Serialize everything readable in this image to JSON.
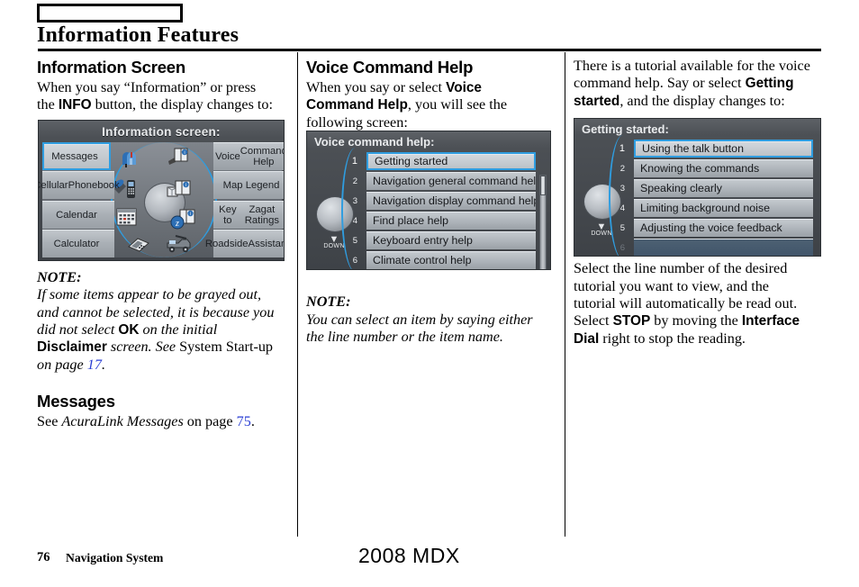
{
  "header": {
    "title": "Information Features",
    "tab_box_label": ""
  },
  "colors": {
    "link": "#2b3fd4",
    "nav_highlight": "#2f9de0"
  },
  "column1": {
    "section_title": "Information Screen",
    "intro_1": "When you say “Information” or press",
    "intro_2_pre": "the ",
    "intro_2_bold": "INFO",
    "intro_2_post": " button, the display changes to:",
    "note_label": "NOTE:",
    "note_l1": "If some items appear to be grayed out,",
    "note_l2": "and cannot be selected, it is because you",
    "note_l3_pre": "did not select ",
    "note_l3_bold": "OK",
    "note_l3_post": " on the initial",
    "note_l4_bold": "Disclaimer",
    "note_l4_mid": " screen. See ",
    "note_l4_rom": "System Start-up",
    "note_l5_pre": "on page ",
    "note_l5_page": "17",
    "note_l5_post": ".",
    "messages_title": "Messages",
    "messages_pre": "See ",
    "messages_italic": "AcuraLink Messages",
    "messages_mid": " on page ",
    "messages_page": "75",
    "messages_post": "."
  },
  "column2": {
    "section_title": "Voice Command Help",
    "intro_pre": "When you say or select ",
    "intro_bold_1": "Voice",
    "intro_bold_2": "Command Help",
    "intro_post": ", you will see the",
    "intro_last": "following screen:",
    "note_label": "NOTE:",
    "note_l1": "You can select an item by saying either",
    "note_l2": "the line number or the item name."
  },
  "column3": {
    "intro_l1": "There is a tutorial available for the voice",
    "intro_l2_pre": "command help. Say or select ",
    "intro_l2_bold": "Getting",
    "intro_l3_bold": "started",
    "intro_l3_post": ", and the display changes to:",
    "after_l1": "Select the line number of the desired",
    "after_l2": "tutorial you want to view, and the",
    "after_l3": "tutorial will automatically be read out.",
    "after_l4_pre": "Select ",
    "after_l4_bold": "STOP",
    "after_l4_mid": " by moving the ",
    "after_l4_bold2": "Interface",
    "after_l5_bold": "Dial",
    "after_l5_post": " right to stop the reading."
  },
  "screen_information": {
    "title": "Information screen:",
    "left_items": [
      {
        "label": "Messages",
        "selected": true
      },
      {
        "label": "Cellular\nPhonebook",
        "selected": false
      },
      {
        "label": "Calendar",
        "selected": false
      },
      {
        "label": "Calculator",
        "selected": false
      }
    ],
    "right_items": [
      {
        "label": "Voice\nCommand Help",
        "selected": false
      },
      {
        "label": "Map Legend",
        "selected": false
      },
      {
        "label": "Key to\nZagat Ratings",
        "selected": false
      },
      {
        "label": "Roadside\nAssistance",
        "selected": false
      }
    ],
    "icons": [
      "mailbox-icon",
      "book-info-icon",
      "satellite-phone-icon",
      "map-book-icon",
      "calendar-icon",
      "zagat-book-icon",
      "calculator-icon",
      "tow-truck-icon"
    ]
  },
  "screen_voice_command_help": {
    "title": "Voice command help:",
    "down_label": "DOWN",
    "rows": [
      {
        "num": "1",
        "label": "Getting started",
        "selected": true
      },
      {
        "num": "2",
        "label": "Navigation general command help",
        "selected": false
      },
      {
        "num": "3",
        "label": "Navigation display command help",
        "selected": false
      },
      {
        "num": "4",
        "label": "Find place help",
        "selected": false
      },
      {
        "num": "5",
        "label": "Keyboard entry help",
        "selected": false
      },
      {
        "num": "6",
        "label": "Climate control help",
        "selected": false
      }
    ]
  },
  "screen_getting_started": {
    "title": "Getting started:",
    "down_label": "DOWN",
    "rows": [
      {
        "num": "1",
        "label": "Using the talk button",
        "selected": true
      },
      {
        "num": "2",
        "label": "Knowing the commands",
        "selected": false
      },
      {
        "num": "3",
        "label": "Speaking clearly",
        "selected": false
      },
      {
        "num": "4",
        "label": "Limiting background noise",
        "selected": false
      },
      {
        "num": "5",
        "label": "Adjusting the voice feedback",
        "selected": false
      },
      {
        "num": "6",
        "label": "",
        "selected": false
      }
    ]
  },
  "footer": {
    "page_number": "76",
    "section_name": "Navigation System",
    "model": "2008  MDX"
  }
}
